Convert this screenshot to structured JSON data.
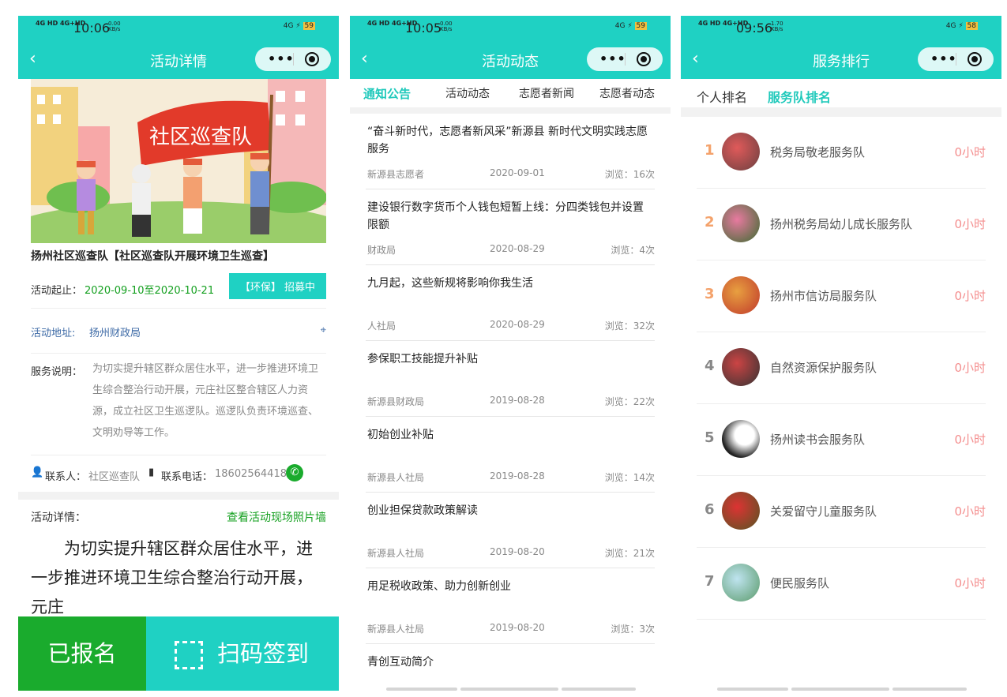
{
  "screens": [
    {
      "status": {
        "time": "10:06",
        "kbs": "0.00\nKB/s",
        "signal": "4G HD 4G+HD",
        "battery": "59"
      },
      "nav_title": "活动详情",
      "detail_title": "扬州社区巡查队【社区巡查队开展环境卫生巡查】",
      "period_label": "活动起止：",
      "period_value": "2020-09-10至2020-10-21",
      "tag": "【环保】 招募中",
      "address_label": "活动地址:",
      "address_value": "扬州财政局",
      "desc_label": "服务说明：",
      "desc_value": "为切实提升辖区群众居住水平，进一步推进环境卫生综合整治行动开展，元庄社区整合辖区人力资源，成立社区卫生巡逻队。巡逻队负责环境巡查、文明劝导等工作。",
      "contact_label": "联系人：",
      "contact_value": "社区巡查队",
      "phone_label": "联系电话：",
      "phone_value": "18602564418",
      "detail_label": "活动详情：",
      "photo_wall_link": "查看活动现场照片墙",
      "detail_body": "为切实提升辖区群众居住水平，进一步推进环境卫生综合整治行动开展，元庄",
      "banner_flag_text": "社区巡查队",
      "btn_signed": "已报名",
      "btn_scan": "扫码签到"
    },
    {
      "status": {
        "time": "10:05",
        "kbs": "0.00\nKB/s",
        "signal": "4G HD 4G+HD",
        "battery": "59"
      },
      "nav_title": "活动动态",
      "tabs": [
        "通知公告",
        "活动动态",
        "志愿者新闻",
        "志愿者动态"
      ],
      "news": [
        {
          "title": "“奋斗新时代，志愿者新风采”新源县 新时代文明实践志愿服务",
          "source": "新源县志愿者",
          "date": "2020-09-01",
          "views": "浏览：16次"
        },
        {
          "title": "建设银行数字货币个人钱包短暂上线：分四类钱包并设置限额",
          "source": "财政局",
          "date": "2020-08-29",
          "views": "浏览：4次"
        },
        {
          "title": "九月起，这些新规将影响你我生活",
          "source": "人社局",
          "date": "2020-08-29",
          "views": "浏览：32次"
        },
        {
          "title": "参保职工技能提升补贴",
          "source": "新源县财政局",
          "date": "2019-08-28",
          "views": "浏览：22次"
        },
        {
          "title": "初始创业补贴",
          "source": "新源县人社局",
          "date": "2019-08-28",
          "views": "浏览：14次"
        },
        {
          "title": "创业担保贷款政策解读",
          "source": "新源县人社局",
          "date": "2019-08-20",
          "views": "浏览：21次"
        },
        {
          "title": "用足税收政策、助力创新创业",
          "source": "新源县人社局",
          "date": "2019-08-20",
          "views": "浏览：3次"
        },
        {
          "title": "青创互动简介",
          "source": "",
          "date": "",
          "views": ""
        }
      ]
    },
    {
      "status": {
        "time": "09:56",
        "kbs": "1.70\nKB/s",
        "signal": "4G HD 4G+HD",
        "battery": "58"
      },
      "nav_title": "服务排行",
      "tabs": [
        "个人排名",
        "服务队排名"
      ],
      "ranks": [
        {
          "num": "1",
          "name": "税务局敬老服务队",
          "hours": "0小时"
        },
        {
          "num": "2",
          "name": "扬州税务局幼儿成长服务队",
          "hours": "0小时"
        },
        {
          "num": "3",
          "name": "扬州市信访局服务队",
          "hours": "0小时"
        },
        {
          "num": "4",
          "name": "自然资源保护服务队",
          "hours": "0小时"
        },
        {
          "num": "5",
          "name": "扬州读书会服务队",
          "hours": "0小时"
        },
        {
          "num": "6",
          "name": "关爱留守儿童服务队",
          "hours": "0小时"
        },
        {
          "num": "7",
          "name": "便民服务队",
          "hours": "0小时"
        }
      ]
    }
  ],
  "colors": {
    "accent": "#1fd1c3",
    "green": "#1aab2d",
    "rank_top": "#f4a26b",
    "rank_rest": "#888888",
    "hours": "#f48e8e"
  }
}
